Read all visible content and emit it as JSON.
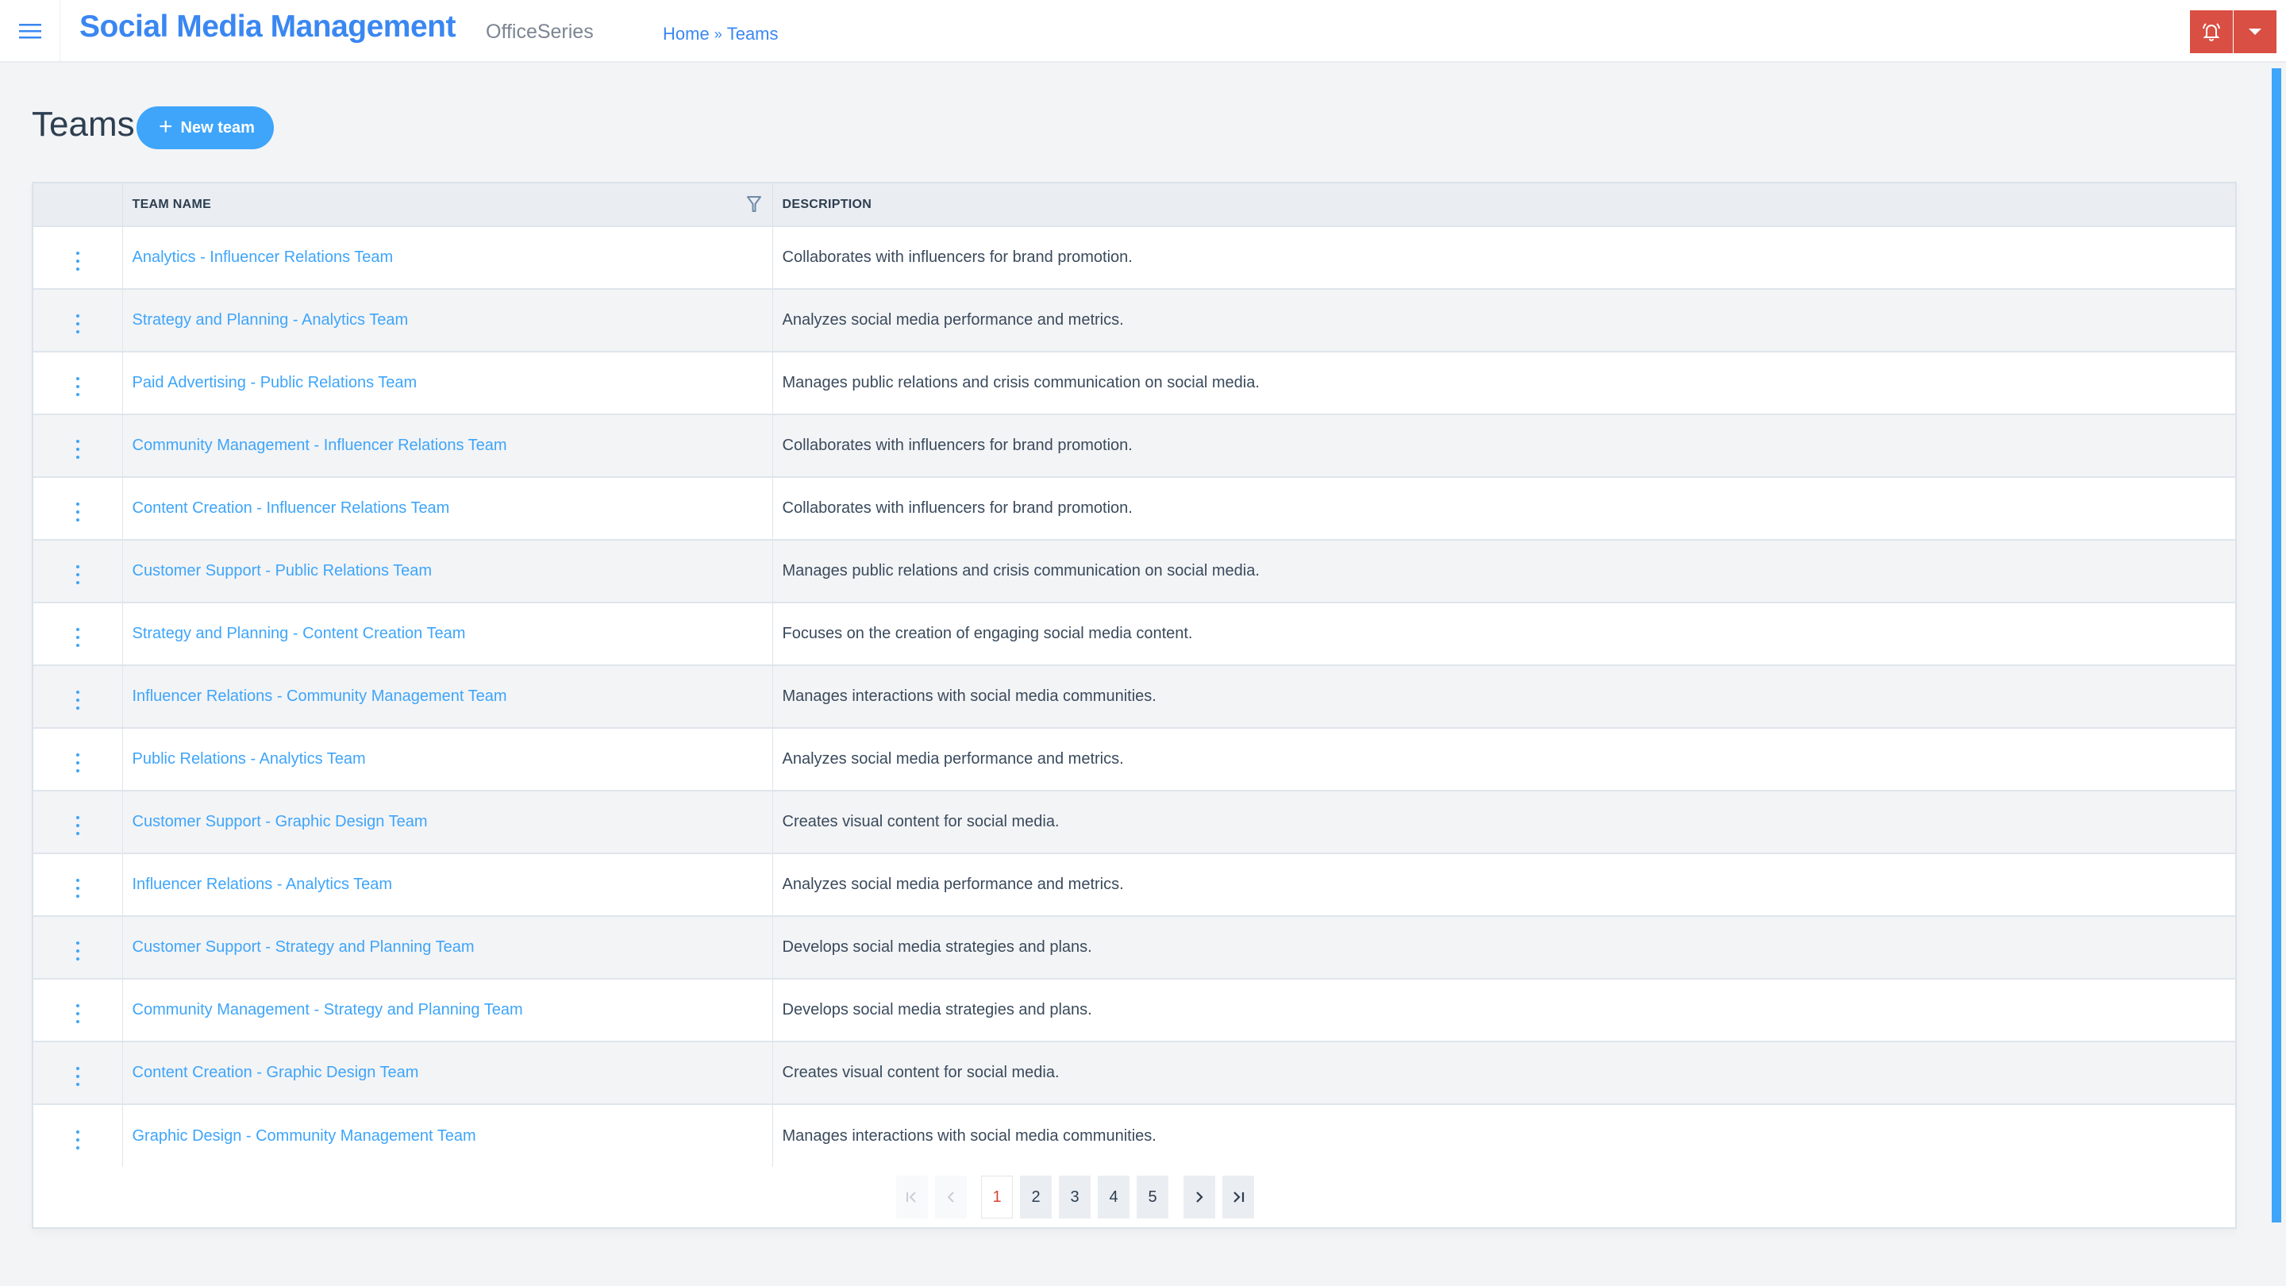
{
  "header": {
    "app_title": "Social Media Management",
    "app_subtitle": "OfficeSeries",
    "breadcrumb": [
      {
        "label": "Home"
      },
      {
        "label": "Teams"
      }
    ],
    "breadcrumb_separator": "»",
    "menu_icon": "hamburger-icon",
    "alert_icon": "bell-ring-icon",
    "dropdown_icon": "caret-down-icon",
    "colors": {
      "brand": "#3a87f2",
      "alert": "#d94f43"
    }
  },
  "page": {
    "title": "Teams",
    "new_button_label": "New team",
    "accent": "#3ea5fa"
  },
  "table": {
    "columns": [
      "",
      "TEAM NAME",
      "DESCRIPTION"
    ],
    "filter_icon": "filter-icon",
    "row_action_icon": "kebab-menu-icon",
    "rows": [
      {
        "name": "Analytics - Influencer Relations Team",
        "description": "Collaborates with influencers for brand promotion."
      },
      {
        "name": "Strategy and Planning - Analytics Team",
        "description": "Analyzes social media performance and metrics."
      },
      {
        "name": "Paid Advertising - Public Relations Team",
        "description": "Manages public relations and crisis communication on social media."
      },
      {
        "name": "Community Management - Influencer Relations Team",
        "description": "Collaborates with influencers for brand promotion."
      },
      {
        "name": "Content Creation - Influencer Relations Team",
        "description": "Collaborates with influencers for brand promotion."
      },
      {
        "name": "Customer Support - Public Relations Team",
        "description": "Manages public relations and crisis communication on social media."
      },
      {
        "name": "Strategy and Planning - Content Creation Team",
        "description": "Focuses on the creation of engaging social media content."
      },
      {
        "name": "Influencer Relations - Community Management Team",
        "description": "Manages interactions with social media communities."
      },
      {
        "name": "Public Relations - Analytics Team",
        "description": "Analyzes social media performance and metrics."
      },
      {
        "name": "Customer Support - Graphic Design Team",
        "description": "Creates visual content for social media."
      },
      {
        "name": "Influencer Relations - Analytics Team",
        "description": "Analyzes social media performance and metrics."
      },
      {
        "name": "Customer Support - Strategy and Planning Team",
        "description": "Develops social media strategies and plans."
      },
      {
        "name": "Community Management - Strategy and Planning Team",
        "description": "Develops social media strategies and plans."
      },
      {
        "name": "Content Creation - Graphic Design Team",
        "description": "Creates visual content for social media."
      },
      {
        "name": "Graphic Design - Community Management Team",
        "description": "Manages interactions with social media communities."
      }
    ]
  },
  "pagination": {
    "current_page": "1",
    "pages": [
      "1",
      "2",
      "3",
      "4",
      "5"
    ],
    "first_icon": "first-page-icon",
    "prev_icon": "chevron-left-icon",
    "next_icon": "chevron-right-icon",
    "last_icon": "last-page-icon"
  }
}
